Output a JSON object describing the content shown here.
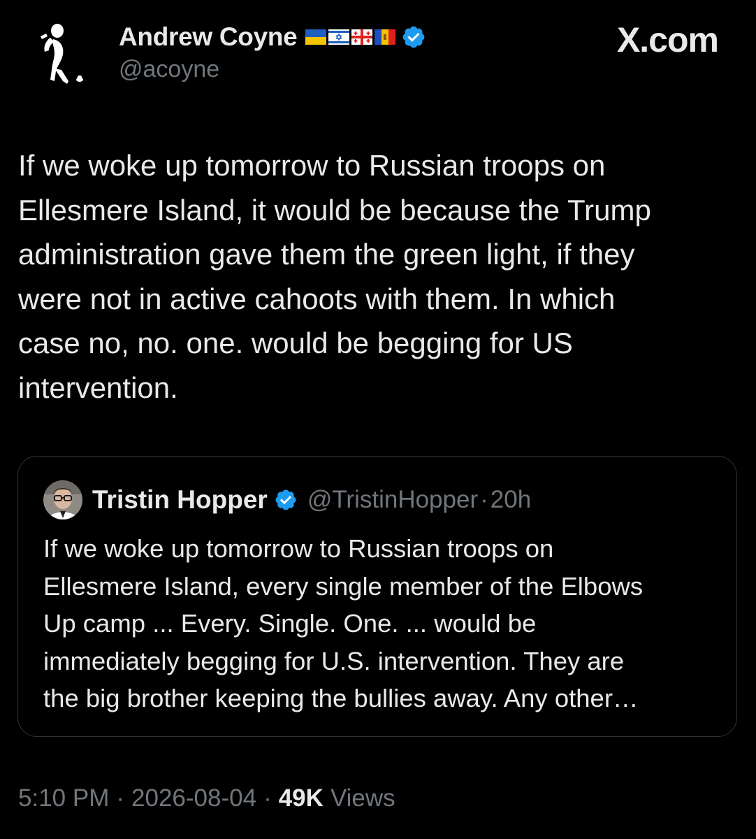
{
  "author": {
    "name": "Andrew Coyne",
    "handle": "@acoyne",
    "flags": [
      "ukraine-flag-icon",
      "israel-flag-icon",
      "georgia-flag-icon",
      "moldova-flag-icon"
    ],
    "verified": true
  },
  "brand": "X.com",
  "tweet": {
    "text": "If we woke up tomorrow to Russian troops on\nEllesmere Island, it would be because the Trump\nadministration gave them the green light, if they\nwere not in active cahoots with them. In which\ncase no, no. one. would be begging for US\nintervention."
  },
  "quote": {
    "name": "Tristin Hopper",
    "handle": "@TristinHopper",
    "separator": "·",
    "time": "20h",
    "verified": true,
    "text": "If we woke up tomorrow to Russian troops on\nEllesmere Island, every single member of the Elbows\nUp camp ... Every. Single. One. ... would be\nimmediately begging for U.S. intervention. They are\nthe big brother keeping the bullies away. Any other…"
  },
  "meta": {
    "time": "5:10 PM",
    "date": "2026-08-04",
    "separator": "·",
    "views_count": "49K",
    "views_label": "Views"
  },
  "colors": {
    "background": "#000000",
    "text": "#e7e9ea",
    "secondary": "#71767b",
    "border": "#2f3336",
    "verified": "#1d9bf0"
  }
}
